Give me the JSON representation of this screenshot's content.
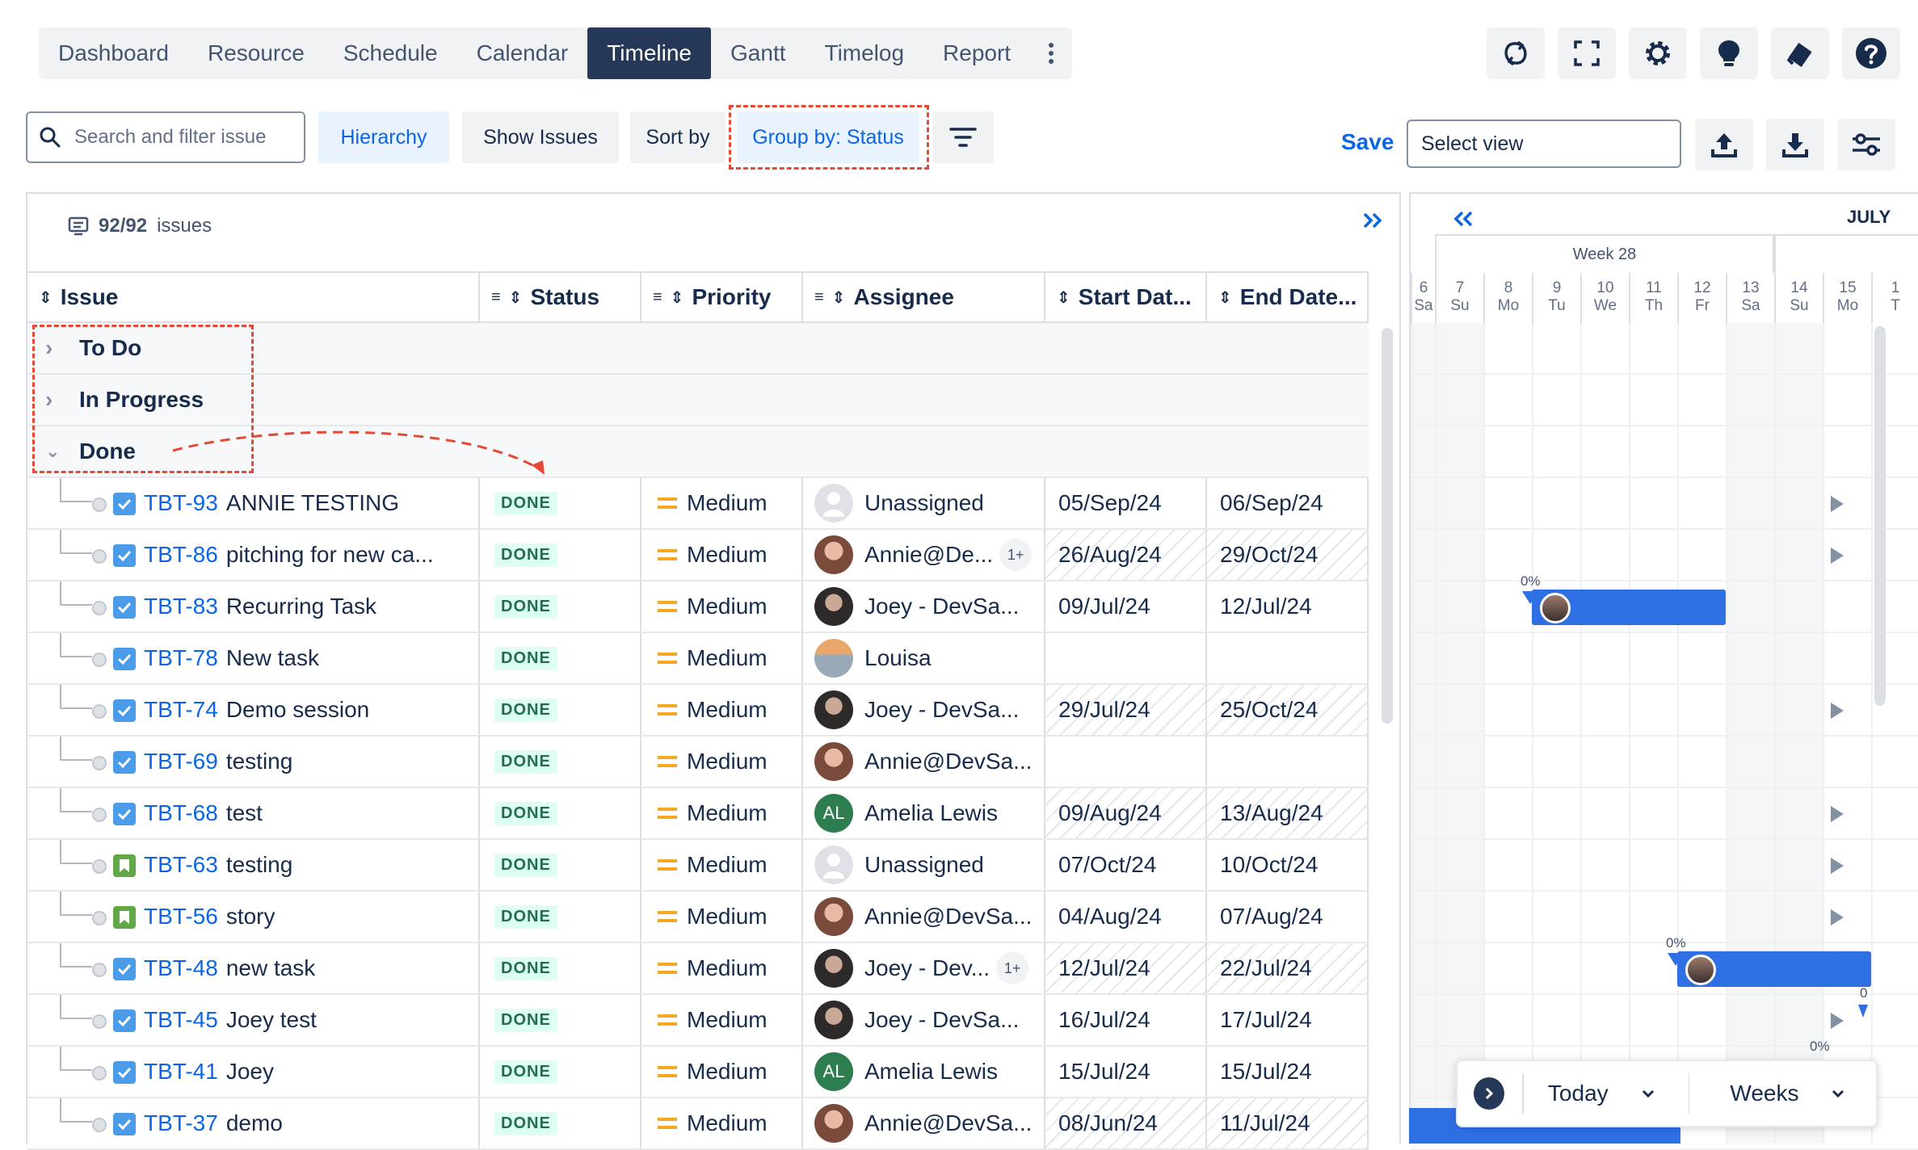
{
  "nav": {
    "tabs": [
      "Dashboard",
      "Resource",
      "Schedule",
      "Calendar",
      "Timeline",
      "Gantt",
      "Timelog",
      "Report"
    ],
    "active": "Timeline"
  },
  "toolbar": {
    "search_placeholder": "Search and filter issue",
    "hierarchy": "Hierarchy",
    "show_issues": "Show Issues",
    "sort_by": "Sort by",
    "group_by": "Group by: Status",
    "save": "Save",
    "select_view_placeholder": "Select view"
  },
  "panel": {
    "issue_count": "92/92",
    "issue_count_suffix": "issues",
    "columns": [
      "Issue",
      "Status",
      "Priority",
      "Assignee",
      "Start Dat...",
      "End Date..."
    ]
  },
  "groups": [
    "To Do",
    "In Progress",
    "Done"
  ],
  "rows": [
    {
      "key": "TBT-93",
      "summary": "ANNIE TESTING",
      "type": "task",
      "status": "DONE",
      "priority": "Medium",
      "assignee": "Unassigned",
      "avatar": "blank",
      "extra": "",
      "start": "05/Sep/24",
      "end": "06/Sep/24",
      "hatch": false
    },
    {
      "key": "TBT-86",
      "summary": "pitching for new ca...",
      "type": "task",
      "status": "DONE",
      "priority": "Medium",
      "assignee": "Annie@De...",
      "avatar": "annie",
      "extra": "1+",
      "start": "26/Aug/24",
      "end": "29/Oct/24",
      "hatch": true
    },
    {
      "key": "TBT-83",
      "summary": "Recurring Task",
      "type": "task",
      "status": "DONE",
      "priority": "Medium",
      "assignee": "Joey - DevSa...",
      "avatar": "joey",
      "extra": "",
      "start": "09/Jul/24",
      "end": "12/Jul/24",
      "hatch": false
    },
    {
      "key": "TBT-78",
      "summary": "New task",
      "type": "task",
      "status": "DONE",
      "priority": "Medium",
      "assignee": "Louisa",
      "avatar": "louisa",
      "extra": "",
      "start": "",
      "end": "",
      "hatch": false
    },
    {
      "key": "TBT-74",
      "summary": "Demo session",
      "type": "task",
      "status": "DONE",
      "priority": "Medium",
      "assignee": "Joey - DevSa...",
      "avatar": "joey",
      "extra": "",
      "start": "29/Jul/24",
      "end": "25/Oct/24",
      "hatch": true
    },
    {
      "key": "TBT-69",
      "summary": "testing",
      "type": "task",
      "status": "DONE",
      "priority": "Medium",
      "assignee": "Annie@DevSa...",
      "avatar": "annie",
      "extra": "",
      "start": "",
      "end": "",
      "hatch": false
    },
    {
      "key": "TBT-68",
      "summary": "test",
      "type": "task",
      "status": "DONE",
      "priority": "Medium",
      "assignee": "Amelia Lewis",
      "avatar": "AL",
      "extra": "",
      "start": "09/Aug/24",
      "end": "13/Aug/24",
      "hatch": true
    },
    {
      "key": "TBT-63",
      "summary": "testing",
      "type": "story",
      "status": "DONE",
      "priority": "Medium",
      "assignee": "Unassigned",
      "avatar": "blank",
      "extra": "",
      "start": "07/Oct/24",
      "end": "10/Oct/24",
      "hatch": false
    },
    {
      "key": "TBT-56",
      "summary": "story",
      "type": "story",
      "status": "DONE",
      "priority": "Medium",
      "assignee": "Annie@DevSa...",
      "avatar": "annie",
      "extra": "",
      "start": "04/Aug/24",
      "end": "07/Aug/24",
      "hatch": false
    },
    {
      "key": "TBT-48",
      "summary": "new task",
      "type": "task",
      "status": "DONE",
      "priority": "Medium",
      "assignee": "Joey - Dev...",
      "avatar": "joey",
      "extra": "1+",
      "start": "12/Jul/24",
      "end": "22/Jul/24",
      "hatch": true
    },
    {
      "key": "TBT-45",
      "summary": "Joey test",
      "type": "task",
      "status": "DONE",
      "priority": "Medium",
      "assignee": "Joey - DevSa...",
      "avatar": "joey",
      "extra": "",
      "start": "16/Jul/24",
      "end": "17/Jul/24",
      "hatch": false
    },
    {
      "key": "TBT-41",
      "summary": "Joey",
      "type": "task",
      "status": "DONE",
      "priority": "Medium",
      "assignee": "Amelia Lewis",
      "avatar": "AL",
      "extra": "",
      "start": "15/Jul/24",
      "end": "15/Jul/24",
      "hatch": false
    },
    {
      "key": "TBT-37",
      "summary": "demo",
      "type": "task",
      "status": "DONE",
      "priority": "Medium",
      "assignee": "Annie@DevSa...",
      "avatar": "annie",
      "extra": "",
      "start": "08/Jun/24",
      "end": "11/Jul/24",
      "hatch": true
    }
  ],
  "gantt": {
    "month": "JULY",
    "week": "Week 28",
    "days": [
      {
        "n": "6",
        "d": "Sa"
      },
      {
        "n": "7",
        "d": "Su"
      },
      {
        "n": "8",
        "d": "Mo"
      },
      {
        "n": "9",
        "d": "Tu"
      },
      {
        "n": "10",
        "d": "We"
      },
      {
        "n": "11",
        "d": "Th"
      },
      {
        "n": "12",
        "d": "Fr"
      },
      {
        "n": "13",
        "d": "Sa"
      },
      {
        "n": "14",
        "d": "Su"
      },
      {
        "n": "15",
        "d": "Mo"
      },
      {
        "n": "1",
        "d": "T"
      }
    ],
    "pct_1": "0%",
    "pct_2": "0%",
    "pct_3": "0%",
    "pct_4": "0",
    "today": "Today",
    "scale": "Weeks"
  },
  "colors": {
    "accent": "#0c66e4",
    "nav_active": "#253858",
    "bar": "#2f6fe4",
    "done_bg": "#dcfff1",
    "done_fg": "#216e4e",
    "dashed": "#e34935"
  }
}
